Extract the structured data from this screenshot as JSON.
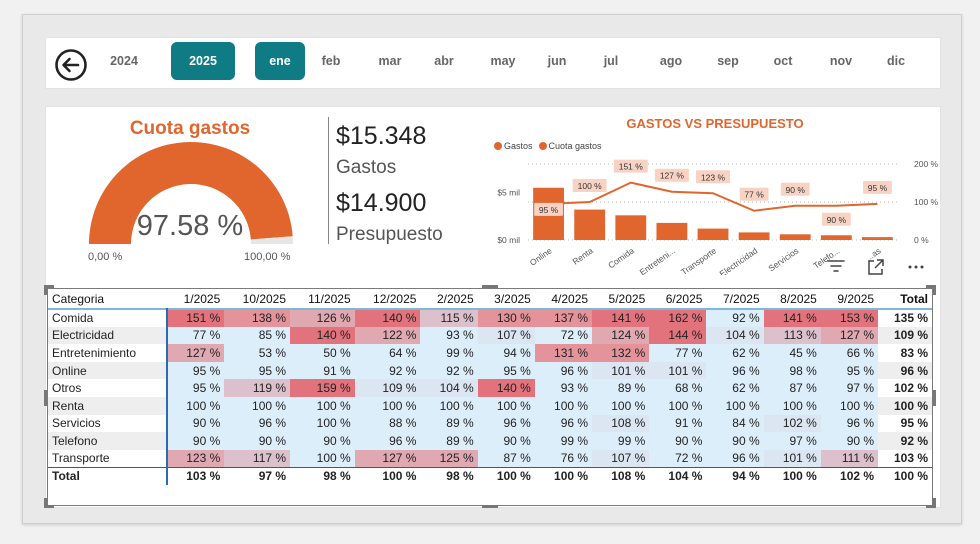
{
  "slicer": {
    "years": [
      {
        "label": "2024",
        "selected": false
      },
      {
        "label": "2025",
        "selected": true
      }
    ],
    "months": [
      {
        "label": "ene",
        "selected": true
      },
      {
        "label": "feb",
        "selected": false
      },
      {
        "label": "mar",
        "selected": false
      },
      {
        "label": "abr",
        "selected": false
      },
      {
        "label": "may",
        "selected": false
      },
      {
        "label": "jun",
        "selected": false
      },
      {
        "label": "jul",
        "selected": false
      },
      {
        "label": "ago",
        "selected": false
      },
      {
        "label": "sep",
        "selected": false
      },
      {
        "label": "oct",
        "selected": false
      },
      {
        "label": "nov",
        "selected": false
      },
      {
        "label": "dic",
        "selected": false
      }
    ]
  },
  "gauge": {
    "title": "Cuota gastos",
    "value": "97.58 %",
    "fraction": 0.9758,
    "min": "0,00 %",
    "max": "100,00 %",
    "color": "#e0662e"
  },
  "kpi": {
    "gastos_value": "$15.348",
    "gastos_label": "Gastos",
    "presupuesto_value": "$14.900",
    "presupuesto_label": "Presupuesto"
  },
  "chart_data": {
    "type": "bar",
    "title": "GASTOS VS PRESUPUESTO",
    "categories": [
      "Online",
      "Renta",
      "Comida",
      "Entreteni...",
      "Transporte",
      "Electricidad",
      "Servicios",
      "Telefo...",
      "...as"
    ],
    "series": [
      {
        "name": "Gastos",
        "type": "bar",
        "values": [
          5.5,
          3.2,
          2.6,
          1.8,
          1.2,
          0.8,
          0.6,
          0.5,
          0.3
        ]
      },
      {
        "name": "Cuota gastos",
        "type": "line",
        "values": [
          95,
          100,
          151,
          127,
          123,
          77,
          90,
          90,
          95
        ],
        "labels": [
          "95 %",
          "100 %",
          "151 %",
          "127 %",
          "123 %",
          "77 %",
          "90 %",
          "90 %",
          "95 %"
        ]
      }
    ],
    "y_left_ticks": [
      "$0 mil",
      "$5 mil"
    ],
    "y_right_ticks": [
      "0 %",
      "100 %",
      "200 %"
    ],
    "color": "#e0662e"
  },
  "table": {
    "headers": [
      "Categoria",
      "1/2025",
      "10/2025",
      "11/2025",
      "12/2025",
      "2/2025",
      "3/2025",
      "4/2025",
      "5/2025",
      "6/2025",
      "7/2025",
      "8/2025",
      "9/2025",
      "Total"
    ],
    "rows": [
      {
        "cat": "Comida",
        "vals": [
          "151 %",
          "138 %",
          "126 %",
          "140 %",
          "115 %",
          "130 %",
          "137 %",
          "141 %",
          "162 %",
          "92 %",
          "141 %",
          "153 %"
        ],
        "total": "135 %"
      },
      {
        "cat": "Electricidad",
        "vals": [
          "77 %",
          "85 %",
          "140 %",
          "122 %",
          "93 %",
          "107 %",
          "72 %",
          "124 %",
          "144 %",
          "104 %",
          "113 %",
          "127 %"
        ],
        "total": "109 %"
      },
      {
        "cat": "Entretenimiento",
        "vals": [
          "127 %",
          "53 %",
          "50 %",
          "64 %",
          "99 %",
          "94 %",
          "131 %",
          "132 %",
          "77 %",
          "62 %",
          "45 %",
          "66 %"
        ],
        "total": "83 %"
      },
      {
        "cat": "Online",
        "vals": [
          "95 %",
          "95 %",
          "91 %",
          "92 %",
          "92 %",
          "95 %",
          "96 %",
          "101 %",
          "101 %",
          "96 %",
          "98 %",
          "95 %"
        ],
        "total": "96 %"
      },
      {
        "cat": "Otros",
        "vals": [
          "95 %",
          "119 %",
          "159 %",
          "109 %",
          "104 %",
          "140 %",
          "93 %",
          "89 %",
          "68 %",
          "62 %",
          "87 %",
          "97 %"
        ],
        "total": "102 %"
      },
      {
        "cat": "Renta",
        "vals": [
          "100 %",
          "100 %",
          "100 %",
          "100 %",
          "100 %",
          "100 %",
          "100 %",
          "100 %",
          "100 %",
          "100 %",
          "100 %",
          "100 %"
        ],
        "total": "100 %"
      },
      {
        "cat": "Servicios",
        "vals": [
          "90 %",
          "96 %",
          "100 %",
          "88 %",
          "89 %",
          "96 %",
          "96 %",
          "108 %",
          "91 %",
          "84 %",
          "102 %",
          "96 %"
        ],
        "total": "95 %"
      },
      {
        "cat": "Telefono",
        "vals": [
          "90 %",
          "90 %",
          "90 %",
          "96 %",
          "89 %",
          "90 %",
          "99 %",
          "99 %",
          "90 %",
          "90 %",
          "97 %",
          "90 %"
        ],
        "total": "92 %"
      },
      {
        "cat": "Transporte",
        "vals": [
          "123 %",
          "117 %",
          "100 %",
          "127 %",
          "125 %",
          "87 %",
          "76 %",
          "107 %",
          "72 %",
          "96 %",
          "101 %",
          "111 %"
        ],
        "total": "103 %"
      }
    ],
    "total_row": {
      "cat": "Total",
      "vals": [
        "103 %",
        "97 %",
        "98 %",
        "100 %",
        "98 %",
        "100 %",
        "100 %",
        "108 %",
        "104 %",
        "94 %",
        "100 %",
        "102 %"
      ],
      "total": "100 %"
    }
  }
}
